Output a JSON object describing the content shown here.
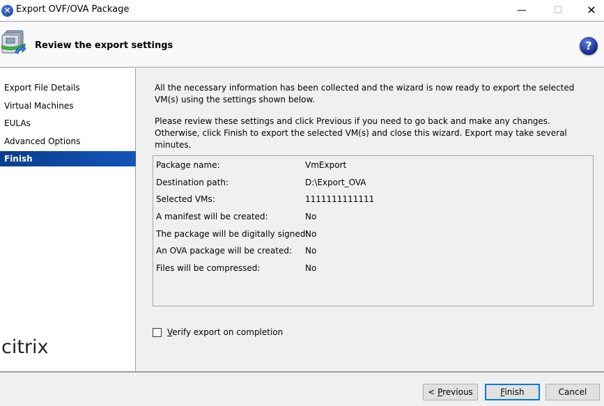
{
  "window": {
    "title": "Export OVF/OVA Package",
    "app_icon": "xencenter-x-icon",
    "controls": {
      "minimize": "—",
      "maximize": "☐",
      "close": "✕"
    }
  },
  "header": {
    "title": "Review the export settings",
    "icon": "vm-export-icon",
    "help_icon_glyph": "?"
  },
  "sidebar": {
    "items": [
      {
        "label": "Export File Details",
        "active": false
      },
      {
        "label": "Virtual Machines",
        "active": false
      },
      {
        "label": "EULAs",
        "active": false
      },
      {
        "label": "Advanced Options",
        "active": false
      },
      {
        "label": "Finish",
        "active": true
      }
    ],
    "logo_text": "citrix"
  },
  "main": {
    "intro": "All the necessary information has been collected and the wizard is now ready to export the selected VM(s) using the settings shown below.",
    "instructions": "Please review these settings and click Previous if you need to go back and make any changes. Otherwise, click Finish to export the selected VM(s) and close this wizard. Export may take several minutes.",
    "summary": [
      {
        "label": "Package name:",
        "value": "VmExport"
      },
      {
        "label": "Destination path:",
        "value": "D:\\Export_OVA"
      },
      {
        "label": "Selected VMs:",
        "value": "1111111111111"
      },
      {
        "label": "A manifest will be created:",
        "value": "No"
      },
      {
        "label": "The package will be digitally signed:",
        "value": "No"
      },
      {
        "label": "An OVA package will be created:",
        "value": "No"
      },
      {
        "label": "Files will be compressed:",
        "value": "No"
      }
    ],
    "verify": {
      "label_mnemonic": "V",
      "label_rest": "erify export on completion",
      "checked": false
    }
  },
  "footer": {
    "previous": {
      "prefix": "< ",
      "mnemonic": "P",
      "rest": "revious"
    },
    "finish": {
      "mnemonic": "F",
      "rest": "inish"
    },
    "cancel": "Cancel"
  }
}
